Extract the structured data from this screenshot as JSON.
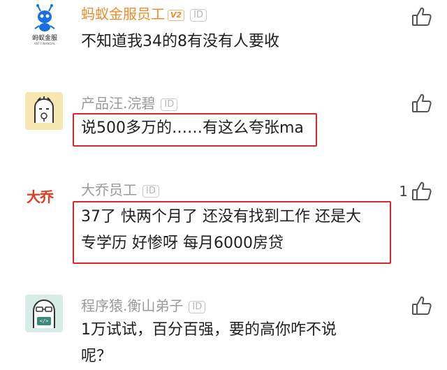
{
  "comments": [
    {
      "username": "蚂蚁金服员工",
      "badge_v": "V2",
      "badge_id": "ID",
      "avatar_text": "蚂蚁金服",
      "avatar_subtext": "ANT FINANCIAL",
      "text_lines": [
        "不知道我34的8有没有人要收"
      ],
      "like_count": "",
      "username_color": "#f08a2a"
    },
    {
      "username": "产品汪.浣碧",
      "badge_id": "ID",
      "text_lines": [
        "说500多万的……有这么夸张ma"
      ],
      "like_count": "",
      "username_color": "#9a9a9a"
    },
    {
      "username": "大乔员工",
      "badge_id": "ID",
      "avatar_text": "大乔",
      "text_lines": [
        "37了 快两个月了 还没有找到工作 还是大",
        "专学历 好惨呀 每月6000房贷"
      ],
      "like_count": "1",
      "username_color": "#9a9a9a"
    },
    {
      "username": "程序猿.衡山弟子",
      "badge_id": "ID",
      "avatar_text": "</>",
      "text_lines": [
        "1万试试，百分百强，要的高你咋不说",
        "呢？"
      ],
      "like_count": "",
      "username_color": "#9a9a9a"
    }
  ],
  "colors": {
    "highlight_box": "#d9262c",
    "avatar2_bg": "#f6e7b0",
    "avatar4_bg": "#d7ece6",
    "ant_blue": "#1a6fe0"
  },
  "icons": [
    "ant-logo-icon",
    "product-dog-avatar-icon",
    "daqiao-logo-icon",
    "programmer-monkey-avatar-icon",
    "thumbs-up-icon"
  ]
}
